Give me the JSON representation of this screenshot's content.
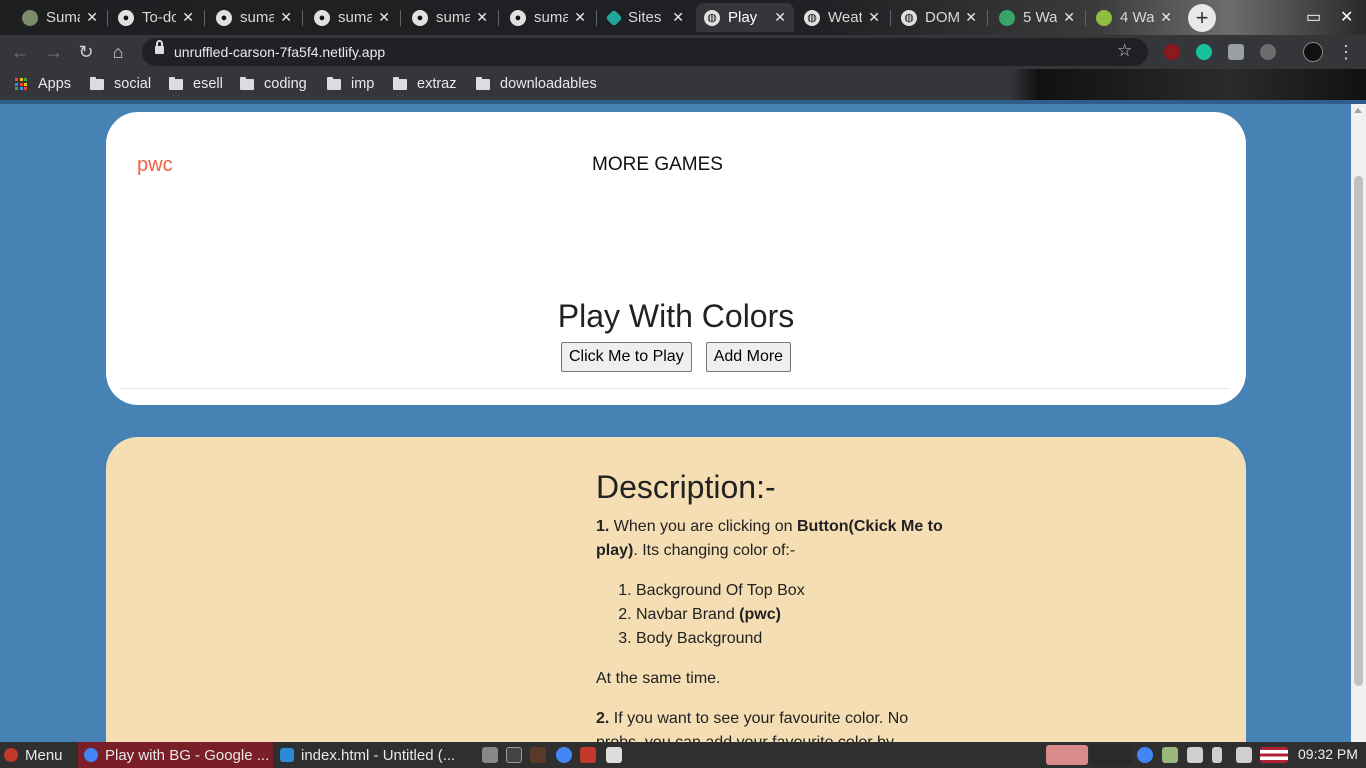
{
  "browser": {
    "tabs": [
      {
        "label": "Suma",
        "icon": "user-avatar-icon",
        "color": "#7a8a6a"
      },
      {
        "label": "To-do",
        "icon": "github-icon",
        "color": "#e0e0e0"
      },
      {
        "label": "suma",
        "icon": "github-icon",
        "color": "#e0e0e0"
      },
      {
        "label": "suma",
        "icon": "github-icon",
        "color": "#e0e0e0"
      },
      {
        "label": "suma",
        "icon": "github-icon",
        "color": "#e0e0e0"
      },
      {
        "label": "suma",
        "icon": "github-icon",
        "color": "#e0e0e0"
      },
      {
        "label": "Sites",
        "icon": "netlify-icon",
        "color": "#1fa89a"
      },
      {
        "label": "Play",
        "icon": "globe-icon",
        "color": "#e0e0e0",
        "active": true
      },
      {
        "label": "Weat",
        "icon": "globe-icon",
        "color": "#e0e0e0"
      },
      {
        "label": "DOM",
        "icon": "globe-icon",
        "color": "#e0e0e0"
      },
      {
        "label": "5 Wa",
        "icon": "site-icon",
        "color": "#3aa56a"
      },
      {
        "label": "4 Wa",
        "icon": "site-icon",
        "color": "#8fbf40"
      }
    ],
    "url": "unruffled-carson-7fa5f4.netlify.app",
    "bookmarks": [
      "Apps",
      "social",
      "esell",
      "coding",
      "imp",
      "extraz",
      "downloadables"
    ]
  },
  "page": {
    "brand": "pwc",
    "nav_link": "MORE GAMES",
    "title": "Play With Colors",
    "play_button": "Click Me to Play",
    "add_button": "Add More",
    "description": {
      "heading": "Description:-",
      "p1_num": "1.",
      "p1_a": " When you are clicking on ",
      "p1_bold": "Button(Ckick Me to play)",
      "p1_b": ". Its changing color of:-",
      "list": [
        "Background Of Top Box",
        "Navbar Brand ",
        "Body Background"
      ],
      "list2_bold": "(pwc)",
      "p_same": "At the same time.",
      "p2_num": "2.",
      "p2_text": " If you want to see your favourite color. No probs, you can add your favourite color by"
    },
    "colors": {
      "body_bg": "#4682b4",
      "top_box": "#ffffff",
      "desc_box": "#f5deb3",
      "brand": "#f06040"
    }
  },
  "taskbar": {
    "menu": "Menu",
    "items": [
      "Play with BG - Google ...",
      "index.html - Untitled (..."
    ],
    "clock": "09:32 PM"
  }
}
